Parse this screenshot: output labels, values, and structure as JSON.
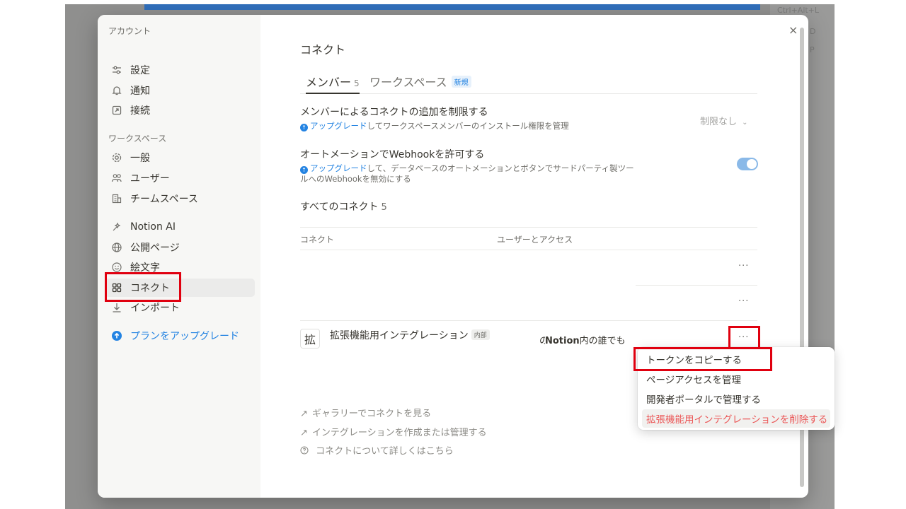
{
  "sidebar": {
    "account_heading": "アカウント",
    "account_items": [
      {
        "label": "設定"
      },
      {
        "label": "通知"
      },
      {
        "label": "接続"
      }
    ],
    "workspace_heading": "ワークスペース",
    "workspace_items": [
      {
        "label": "一般"
      },
      {
        "label": "ユーザー"
      },
      {
        "label": "チームスペース"
      }
    ],
    "feature_items": [
      {
        "label": "Notion AI"
      },
      {
        "label": "公開ページ"
      },
      {
        "label": "絵文字"
      },
      {
        "label": "コネクト",
        "active": true
      },
      {
        "label": "インポート"
      }
    ],
    "upgrade_label": "プランをアップグレード"
  },
  "main": {
    "title": "コネクト",
    "tabs": [
      {
        "label": "メンバー",
        "count": "5",
        "active": true
      },
      {
        "label": "ワークスペース",
        "badge": "新規"
      }
    ],
    "settings": [
      {
        "title": "メンバーによるコネクトの追加を制限する",
        "link": "アップグレード",
        "desc": "してワークスペースメンバーのインストール権限を管理",
        "control": "制限なし"
      },
      {
        "title": "オートメーションでWebhookを許可する",
        "link": "アップグレード",
        "desc": "して、データベースのオートメーションとボタンでサードパーティ製ツールへのWebhookを無効にする",
        "control": "toggle-on"
      }
    ],
    "all_connections_label": "すべてのコネクト",
    "all_connections_count": "5",
    "columns": [
      "コネクト",
      "ユーザーとアクセス"
    ],
    "row_more": "···",
    "integration": {
      "icon_char": "拡",
      "name": "拡張機能用インテグレーション",
      "badge": "内部",
      "access_prefix": "Notion内の誰でも",
      "access_bold": "Notion",
      "access_prefix_char": "の",
      "access_rest": "内の誰でも"
    },
    "footer_links": [
      {
        "label": "ギャラリーでコネクトを見る",
        "icon": "arrow-up-right-icon"
      },
      {
        "label": "インテグレーションを作成または管理する",
        "icon": "arrow-up-right-icon"
      },
      {
        "label": "コネクトについて詳しくはこちら",
        "icon": "help-circle-icon"
      }
    ]
  },
  "context_menu": {
    "items": [
      {
        "label": "トークンをコピーする"
      },
      {
        "label": "ページアクセスを管理"
      },
      {
        "label": "開発者ポータルで管理する"
      },
      {
        "label": "拡張機能用インテグレーションを削除する",
        "danger": true
      }
    ]
  },
  "background": {
    "faint_texts": [
      "Ctrl+Alt+L",
      "D",
      "P"
    ]
  },
  "colors": {
    "accent": "#2383e2",
    "danger": "#eb5757",
    "highlight": "#e0000f",
    "toggle": "#8ab9e8"
  }
}
